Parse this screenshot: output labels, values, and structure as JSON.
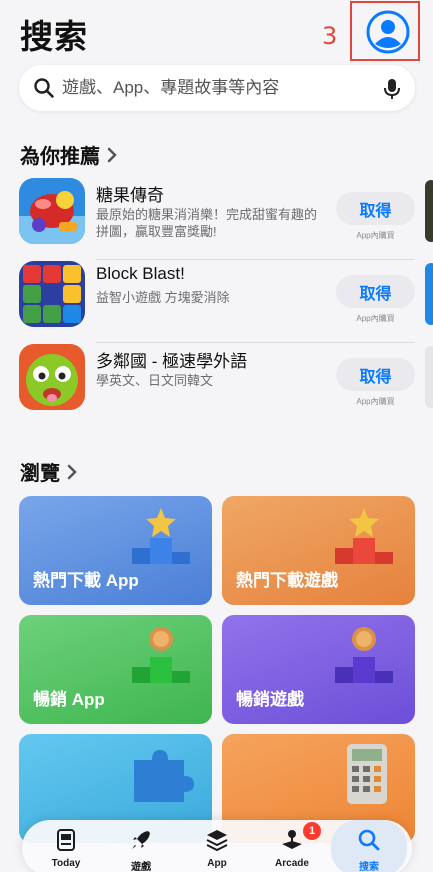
{
  "header": {
    "title": "搜索",
    "annotation_number": "3"
  },
  "search": {
    "placeholder": "遊戲、App、專題故事等內容"
  },
  "recommend": {
    "heading": "為你推薦",
    "apps": [
      {
        "name": "糖果傳奇",
        "desc": "最原始的糖果消消樂！完成甜蜜有趣的拼圖，贏取豐富獎勵!",
        "button": "取得",
        "iap": "App內購買"
      },
      {
        "name": "Block Blast!",
        "desc": "益智小遊戲 方塊愛消除",
        "button": "取得",
        "iap": "App內購買"
      },
      {
        "name": "多鄰國 - 極速學外語",
        "desc": "學英文、日文同韓文",
        "button": "取得",
        "iap": "App內購買"
      }
    ]
  },
  "browse": {
    "heading": "瀏覽",
    "tiles": [
      {
        "label": "熱門下載 App",
        "color": "#5b8fde"
      },
      {
        "label": "熱門下載遊戲",
        "color": "#e8924a"
      },
      {
        "label": "暢銷 App",
        "color": "#4cbf5e"
      },
      {
        "label": "暢銷遊戲",
        "color": "#7a5de0"
      },
      {
        "label": "",
        "color": "#4ab8e4"
      },
      {
        "label": "",
        "color": "#f08a45"
      }
    ]
  },
  "tabbar": {
    "tabs": [
      {
        "label": "Today",
        "icon": "today-icon"
      },
      {
        "label": "遊戲",
        "icon": "rocket-icon"
      },
      {
        "label": "App",
        "icon": "app-stack-icon"
      },
      {
        "label": "Arcade",
        "icon": "arcade-icon",
        "badge": "1"
      },
      {
        "label": "搜索",
        "icon": "search-icon",
        "active": true
      }
    ]
  },
  "colors": {
    "accent": "#0a7aff",
    "annotation": "#e0463c",
    "badge": "#ff3b30"
  }
}
